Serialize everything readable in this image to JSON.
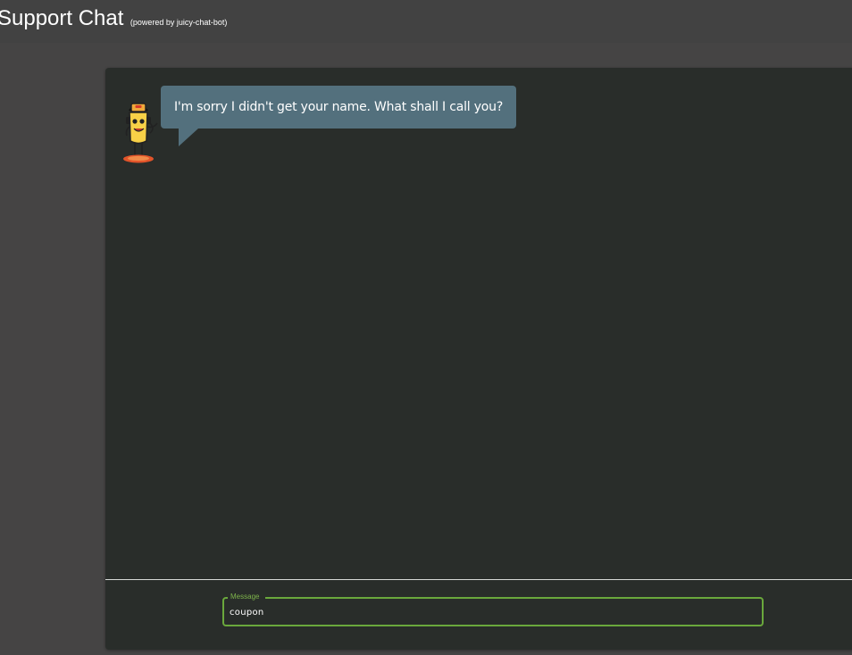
{
  "header": {
    "title": "Support Chat",
    "subtitle": "(powered by juicy-chat-bot)"
  },
  "chat": {
    "bot_avatar_icon": "juicy-bot-icon",
    "messages": [
      {
        "sender": "bot",
        "text": "I'm sorry I didn't get your name. What shall I call you?"
      }
    ]
  },
  "input": {
    "label": "Message",
    "value": "coupon"
  },
  "colors": {
    "page_background": "#454444",
    "card_background": "#292d2a",
    "bubble_background": "#53707d",
    "accent": "#6aa83c"
  }
}
